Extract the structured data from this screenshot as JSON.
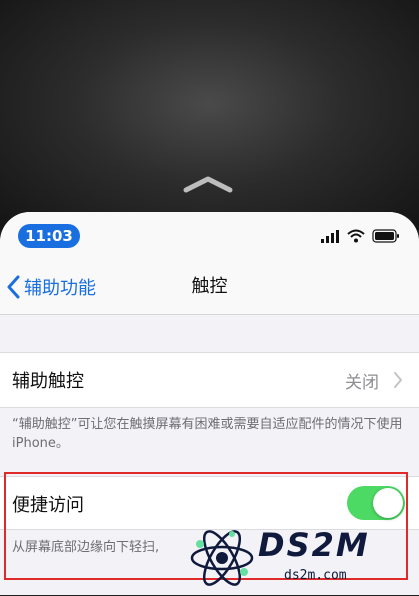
{
  "status_bar": {
    "time": "11:03",
    "icons": [
      "signal-icon",
      "wifi-icon",
      "battery-icon"
    ]
  },
  "nav": {
    "back_label": "辅助功能",
    "title": "触控"
  },
  "assistive_touch": {
    "label": "辅助触控",
    "value": "关闭",
    "footnote": "“辅助触控”可让您在触摸屏幕有困难或需要自适应配件的情况下使用iPhone。"
  },
  "reachability": {
    "label": "便捷访问",
    "enabled": true,
    "footnote": "从屏幕底部边缘向下轻扫,"
  },
  "watermark": {
    "main": "DS2M",
    "sub": "ds2m.com"
  },
  "colors": {
    "accent": "#1a6fe0",
    "toggle_on": "#4cd964",
    "highlight": "#e02a2a"
  }
}
